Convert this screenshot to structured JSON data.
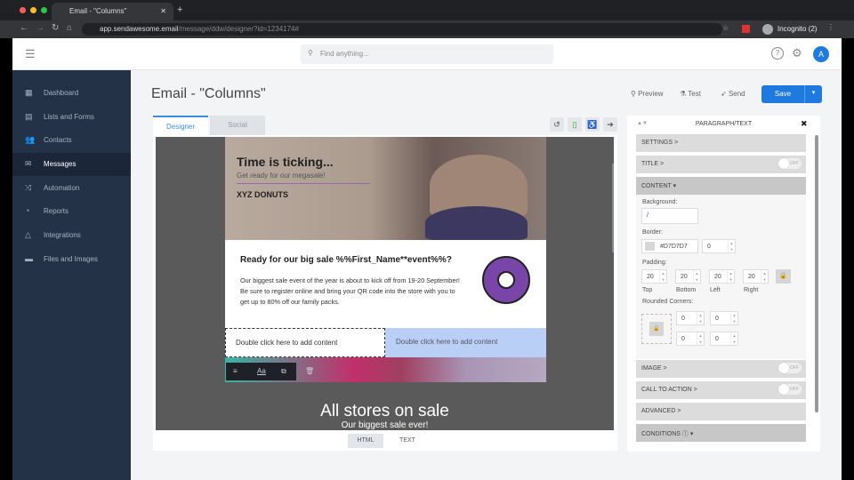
{
  "browser": {
    "tab_title": "Email - \"Columns\"",
    "url_host": "app.sendawesome.email",
    "url_path": "/message/ddw/designer?id=1234174#",
    "profile": "Incognito (2)"
  },
  "header": {
    "search_placeholder": "Find anything...",
    "avatar_initial": "A"
  },
  "sidebar": {
    "items": [
      {
        "label": "Dashboard",
        "icon": "grid-icon"
      },
      {
        "label": "Lists and Forms",
        "icon": "list-icon"
      },
      {
        "label": "Contacts",
        "icon": "contacts-icon"
      },
      {
        "label": "Messages",
        "icon": "messages-icon",
        "active": true
      },
      {
        "label": "Automation",
        "icon": "shuffle-icon"
      },
      {
        "label": "Reports",
        "icon": "pie-chart-icon"
      },
      {
        "label": "Integrations",
        "icon": "integrations-icon"
      },
      {
        "label": "Files and Images",
        "icon": "folder-icon"
      }
    ]
  },
  "page": {
    "title": "Email - \"Columns\"",
    "preview": "Preview",
    "test": "Test",
    "send": "Send",
    "save": "Save"
  },
  "editor": {
    "tabs": [
      "Designer",
      "Social"
    ],
    "active_tab": "Designer",
    "bottom_tabs": [
      "HTML",
      "TEXT"
    ],
    "active_bottom_tab": "HTML"
  },
  "email": {
    "hero_title": "Time is ticking...",
    "hero_subtitle": "Get ready for our megasale!",
    "logo": "XYZ DONUTS",
    "heading": "Ready for our big sale %%First_Name**event%%?",
    "paragraph": "Our biggest sale event of the year is about to kick off from 19-20 September! Be sure to register online and bring your QR code into the store with you to get up to 80% off our family packs.",
    "col_left": "Double click here to add content",
    "col_right": "Double click here to add content",
    "banner_title": "All stores on sale",
    "banner_subtitle": "Our biggest sale ever!"
  },
  "panel": {
    "title": "PARAGRAPH/TEXT",
    "settings": "SETTINGS >",
    "title_sec": "TITLE >",
    "content": "CONTENT ▾",
    "background_label": "Background:",
    "border_label": "Border:",
    "border_color": "#D7D7D7",
    "border_width": "0",
    "padding_label": "Padding:",
    "padding": {
      "top": "20",
      "bottom": "20",
      "left": "20",
      "right": "20"
    },
    "padding_labels": [
      "Top",
      "Bottom",
      "Left",
      "Right"
    ],
    "rounded_label": "Rounded Corners:",
    "corners": [
      "0",
      "0",
      "0",
      "0"
    ],
    "image": "IMAGE >",
    "cta": "CALL TO ACTION >",
    "advanced": "ADVANCED >",
    "conditions": "CONDITIONS ⓘ ▾",
    "toggle_off": "OFF"
  },
  "colors": {
    "accent": "#1f7ae0",
    "sidebar": "#233247",
    "column_highlight": "#b9cff6"
  }
}
